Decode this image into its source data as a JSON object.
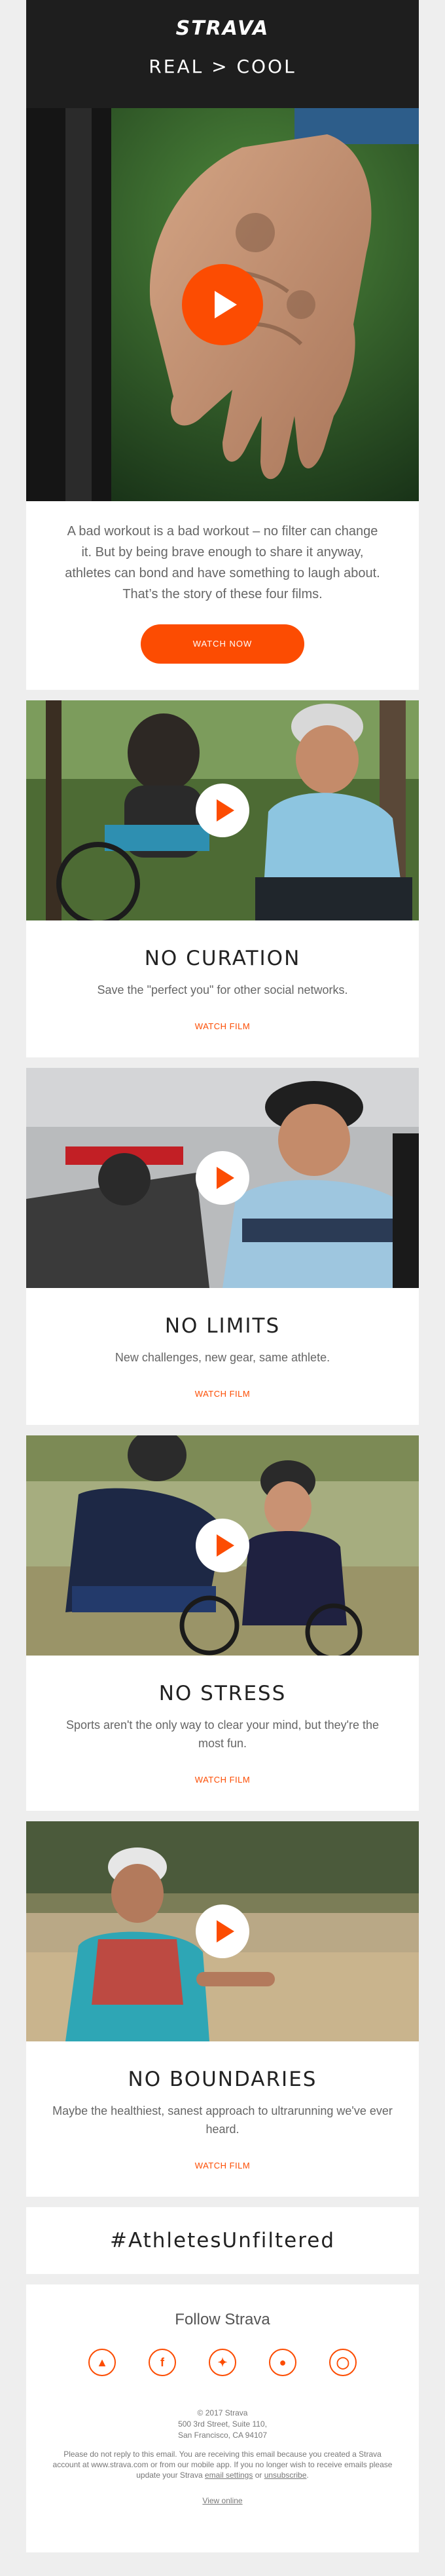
{
  "header": {
    "logo": "STRAVA",
    "headline": "REAL > COOL"
  },
  "intro": {
    "text": "A bad workout is a bad workout – no filter can change it. But by being brave enough to share it anyway, athletes can bond and have something to laugh about. That’s the story of these four films.",
    "button": "WATCH NOW"
  },
  "films": [
    {
      "title": "NO CURATION",
      "desc": "Save the \"perfect you\" for other social networks.",
      "link": "WATCH FILM"
    },
    {
      "title": "NO LIMITS",
      "desc": "New challenges, new gear, same athlete.",
      "link": "WATCH FILM"
    },
    {
      "title": "NO STRESS",
      "desc": "Sports aren't the only way to clear your mind, but they're the most fun.",
      "link": "WATCH FILM"
    },
    {
      "title": "NO BOUNDARIES",
      "desc": "Maybe the healthiest, sanest approach to ultrarunning we've ever heard.",
      "link": "WATCH FILM"
    }
  ],
  "hashtag": "#AthletesUnfiltered",
  "footer": {
    "follow": "Follow Strava",
    "social_icons": [
      "flame-icon",
      "facebook-icon",
      "twitter-icon",
      "snapchat-icon",
      "instagram-icon"
    ],
    "copyright": "© 2017 Strava",
    "address1": "500 3rd Street, Suite 110,",
    "address2": "San Francisco, CA 94107",
    "disclaimer_a": "Please do not reply to this email. You are receiving this email because you created a Strava account at www.strava.com or from our mobile app. If you no longer wish to receive emails please update your Strava",
    "settings_link": "email settings",
    "or": "or",
    "unsubscribe": "unsubscribe",
    "view_online": "View online"
  },
  "colors": {
    "accent": "#fc4c02",
    "header_bg": "#1e1e1e",
    "page_bg": "#eeeeee"
  }
}
